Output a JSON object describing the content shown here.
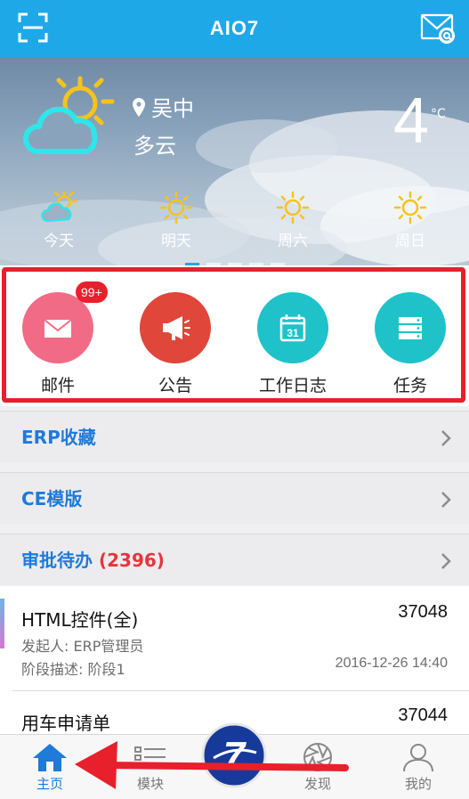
{
  "header": {
    "title": "AIO7",
    "scan_icon": "scan-icon",
    "mail_icon": "mail-at-icon"
  },
  "weather": {
    "location": "吴中",
    "condition": "多云",
    "temperature": "4",
    "unit": "°C",
    "forecast": [
      {
        "day": "今天",
        "icon": "partly-cloudy-icon"
      },
      {
        "day": "明天",
        "icon": "sun-icon"
      },
      {
        "day": "周六",
        "icon": "sun-icon"
      },
      {
        "day": "周日",
        "icon": "sun-icon"
      }
    ],
    "pager_count": 5,
    "pager_active": 0
  },
  "quick_actions": [
    {
      "label": "邮件",
      "icon": "envelope-icon",
      "color": "#f26b86",
      "badge": "99+"
    },
    {
      "label": "公告",
      "icon": "megaphone-icon",
      "color": "#e0463a"
    },
    {
      "label": "工作日志",
      "icon": "calendar-icon",
      "color": "#1fc2c9"
    },
    {
      "label": "任务",
      "icon": "task-list-icon",
      "color": "#1fc2c9"
    }
  ],
  "sections": {
    "erp": {
      "title": "ERP收藏"
    },
    "ce": {
      "title": "CE模版"
    },
    "approval": {
      "title": "审批待办",
      "count": "(2396)"
    }
  },
  "approval_items": [
    {
      "name": "HTML控件(全)",
      "number": "37048",
      "initiator": "发起人: ERP管理员",
      "stage": "阶段描述: 阶段1",
      "time": "2016-12-26 14:40"
    },
    {
      "name": "用车申请单",
      "number": "37044"
    }
  ],
  "bottom_nav": {
    "tabs": [
      {
        "label": "主页",
        "icon": "home-icon",
        "active": true
      },
      {
        "label": "模块",
        "icon": "modules-icon"
      },
      {
        "label": "发现",
        "icon": "aperture-icon"
      },
      {
        "label": "我的",
        "icon": "user-icon"
      }
    ],
    "center_label": "7"
  },
  "colors": {
    "accent": "#1fa8e8",
    "highlight": "#e8202c",
    "link": "#1f7ad8"
  }
}
